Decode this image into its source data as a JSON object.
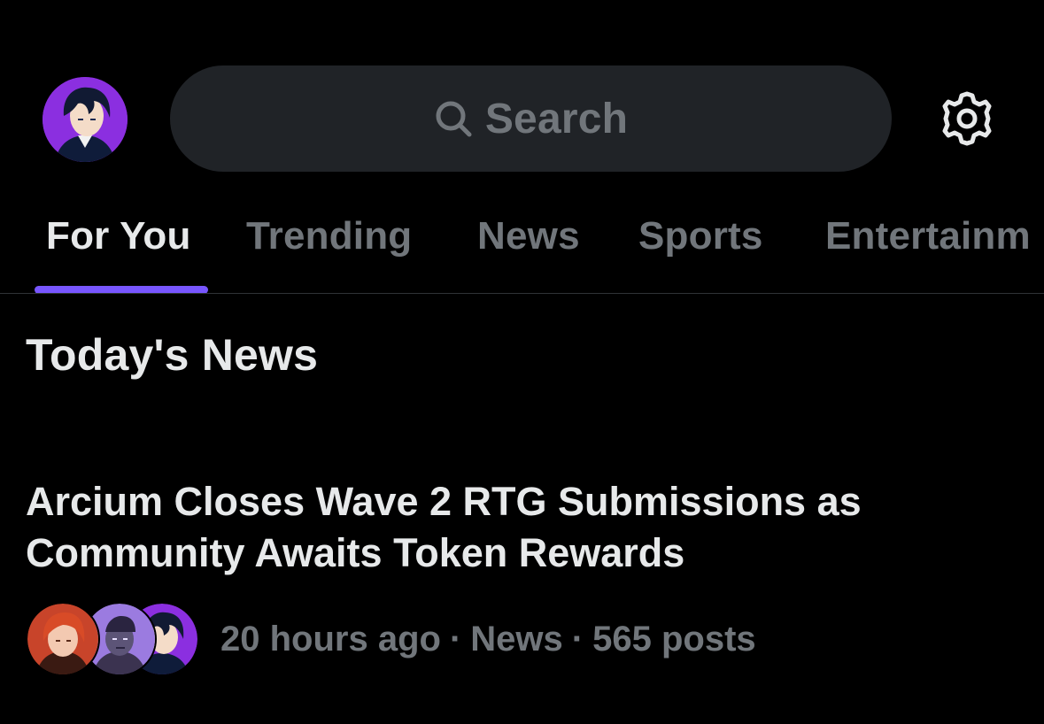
{
  "header": {
    "avatar_icon": "profile-avatar-anime-boy",
    "search": {
      "placeholder": "Search",
      "icon": "search-icon"
    },
    "settings_icon": "gear-icon"
  },
  "tabs": [
    {
      "label": "For You",
      "active": true
    },
    {
      "label": "Trending",
      "active": false
    },
    {
      "label": "News",
      "active": false
    },
    {
      "label": "Sports",
      "active": false
    },
    {
      "label": "Entertainm",
      "active": false
    }
  ],
  "section": {
    "title": "Today's News"
  },
  "stories": [
    {
      "headline": "Arcium Closes Wave 2 RTG Submissions as Community Awaits Token Rewards",
      "time": "20 hours ago",
      "category": "News",
      "posts": "565 posts",
      "separator": "·",
      "avatars": [
        "avatar-red-hair-woman",
        "avatar-purple-man",
        "avatar-anime-boy"
      ]
    }
  ],
  "colors": {
    "background": "#000000",
    "search_bg": "#202327",
    "text_primary": "#e7e9ea",
    "text_secondary": "#71767b",
    "accent": "#7856ff",
    "divider": "#2f3336"
  }
}
